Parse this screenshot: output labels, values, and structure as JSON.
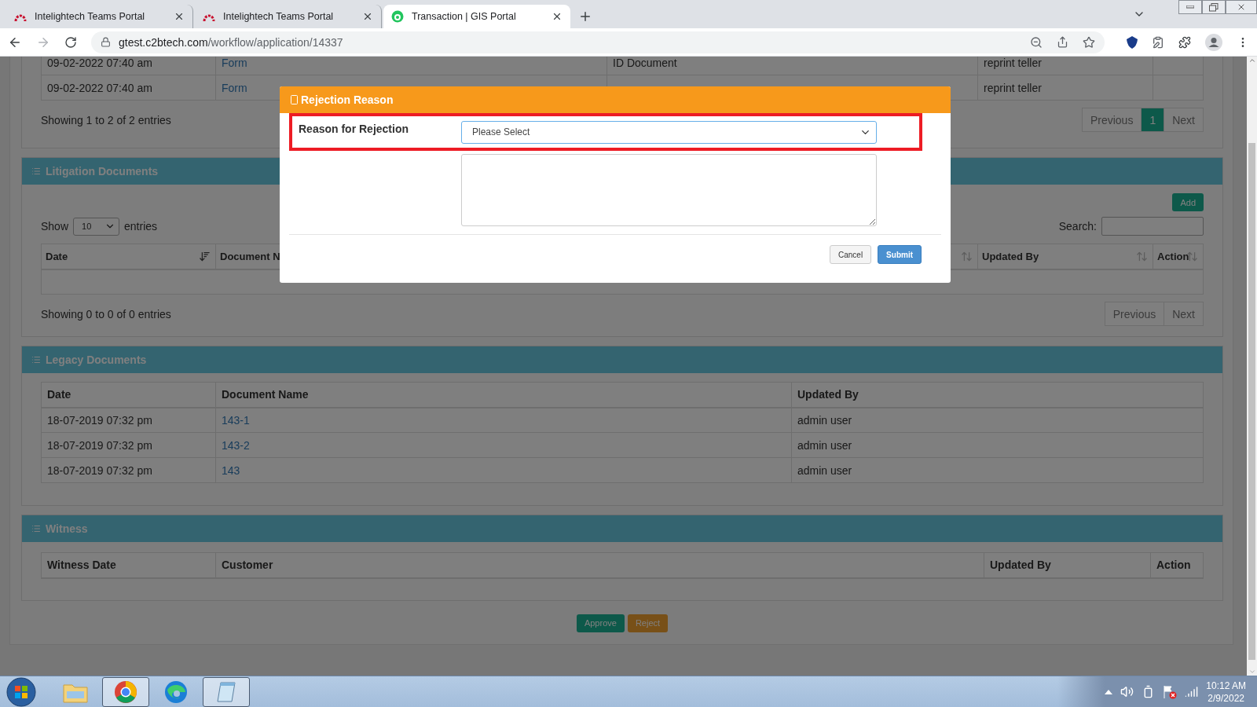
{
  "browser": {
    "tabs": [
      {
        "title": "Intelightech Teams Portal",
        "kind": "arch",
        "selected": false
      },
      {
        "title": "Intelightech Teams Portal",
        "kind": "arch",
        "selected": false
      },
      {
        "title": "Transaction | GIS Portal",
        "kind": "globe",
        "selected": true
      }
    ],
    "url": {
      "host": "gtest.c2btech.com",
      "path": "/workflow/application/14337"
    }
  },
  "page": {
    "top_table": {
      "rows": [
        {
          "column_1": "09-02-2022 07:40 am",
          "column_2": "Form",
          "column_3": "ID Document",
          "column_4": "reprint teller"
        },
        {
          "column_1": "09-02-2022 07:40 am",
          "column_2": "Form",
          "column_4": "reprint teller"
        }
      ],
      "info": "Showing 1 to 2 of 2 entries",
      "pagination": {
        "previous": "Previous",
        "pages": [
          {
            "label": "1",
            "selected": true
          }
        ],
        "next": "Next"
      }
    },
    "litigation": {
      "title": "Litigation Documents",
      "add_button": "Add",
      "length": {
        "before": "Show",
        "value": "10",
        "after": "entries"
      },
      "search_label": "Search:",
      "columns": [
        {
          "label": "Date",
          "sorted": true
        },
        {
          "label": "Document N"
        },
        {
          "sorted": false
        },
        {
          "label": "Updated By",
          "sorted": false
        },
        {
          "label": "Action",
          "sorted": false
        }
      ],
      "info": "Showing 0 to 0 of 0 entries",
      "pagination": {
        "previous": "Previous",
        "next": "Next"
      }
    },
    "legacy": {
      "title": "Legacy Documents",
      "columns": [
        "Date",
        "Document Name",
        "Updated By"
      ],
      "rows": [
        [
          "18-07-2019 07:32 pm",
          "143-1",
          "admin user"
        ],
        [
          "18-07-2019 07:32 pm",
          "143-2",
          "admin user"
        ],
        [
          "18-07-2019 07:32 pm",
          "143",
          "admin user"
        ]
      ]
    },
    "witness": {
      "title": "Witness",
      "columns": [
        "Witness Date",
        "Customer",
        "Updated By",
        "Action"
      ]
    },
    "actions": {
      "approve": "Approve",
      "reject": "Reject"
    }
  },
  "modal": {
    "title": "Rejection Reason",
    "field_label": "Reason for Rejection",
    "select_value": "Please Select",
    "cancel": "Cancel",
    "submit": "Submit"
  },
  "taskbar": {
    "apps": [
      {
        "kind": "explorer",
        "running": false
      },
      {
        "kind": "chrome",
        "running": true
      },
      {
        "kind": "edge",
        "running": false
      },
      {
        "kind": "notepad",
        "running": true
      }
    ],
    "time": "10:12 AM",
    "date": "2/9/2022"
  }
}
